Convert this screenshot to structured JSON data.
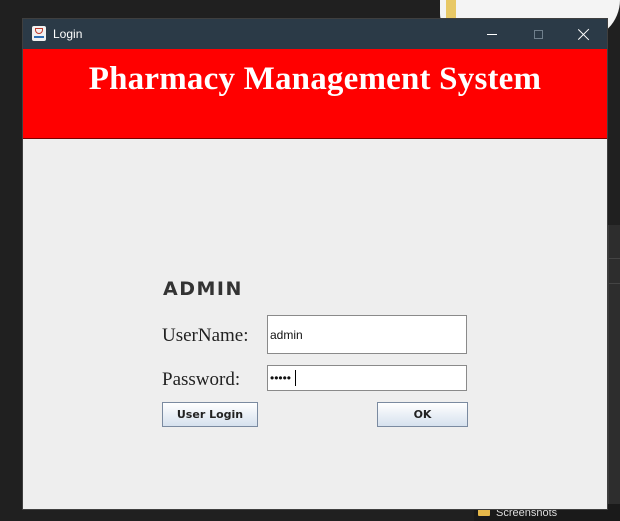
{
  "window": {
    "title": "Login",
    "app_icon": "java-cup-icon"
  },
  "header": {
    "title": "Pharmacy Management System",
    "background": "#ff0000",
    "text_color": "#ffffff"
  },
  "form": {
    "role_heading": "ADMIN",
    "username_label": "UserName:",
    "username_value": "admin",
    "password_label": "Password:",
    "password_value": "•••••",
    "user_login_button": "User Login",
    "ok_button": "OK"
  },
  "desktop": {
    "taskbar_item": "Screenshots",
    "taskbar_icon": "folder-icon"
  }
}
